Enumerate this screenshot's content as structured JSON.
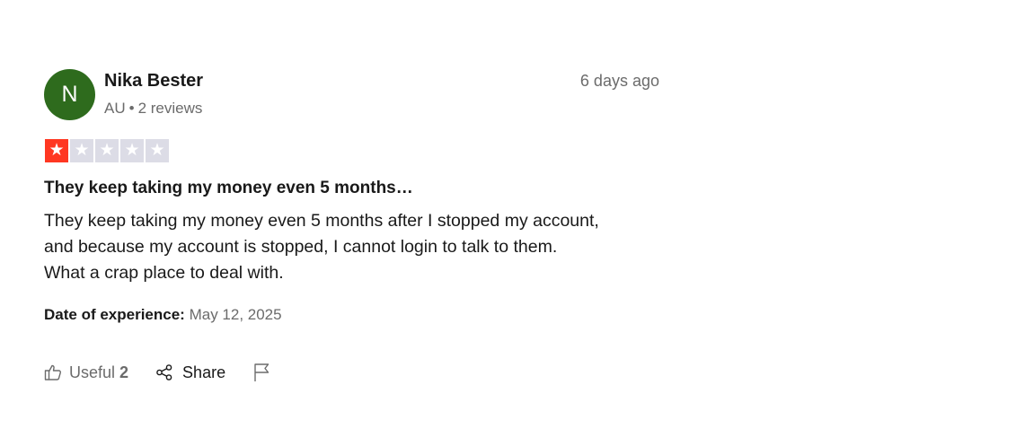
{
  "review": {
    "avatar_initial": "N",
    "author_name": "Nika Bester",
    "country": "AU",
    "review_count": "2 reviews",
    "posted": "6 days ago",
    "rating": 1,
    "rating_max": 5,
    "title": "They keep taking my money even 5 months…",
    "body_lines": [
      "They keep taking my money even 5 months after I stopped my account,",
      "and because my account is stopped, I cannot login to talk to them.",
      "What a crap place to deal with."
    ],
    "experience_label": "Date of experience:",
    "experience_date": "May 12, 2025"
  },
  "actions": {
    "useful_label": "Useful",
    "useful_count": "2",
    "share_label": "Share"
  },
  "colors": {
    "avatar_bg": "#2e6b1d",
    "star_filled": "#ff3722",
    "star_empty": "#dcdce6"
  },
  "icons": {
    "useful": "thumbs-up-icon",
    "share": "share-icon",
    "flag": "flag-icon",
    "star": "star-icon"
  }
}
